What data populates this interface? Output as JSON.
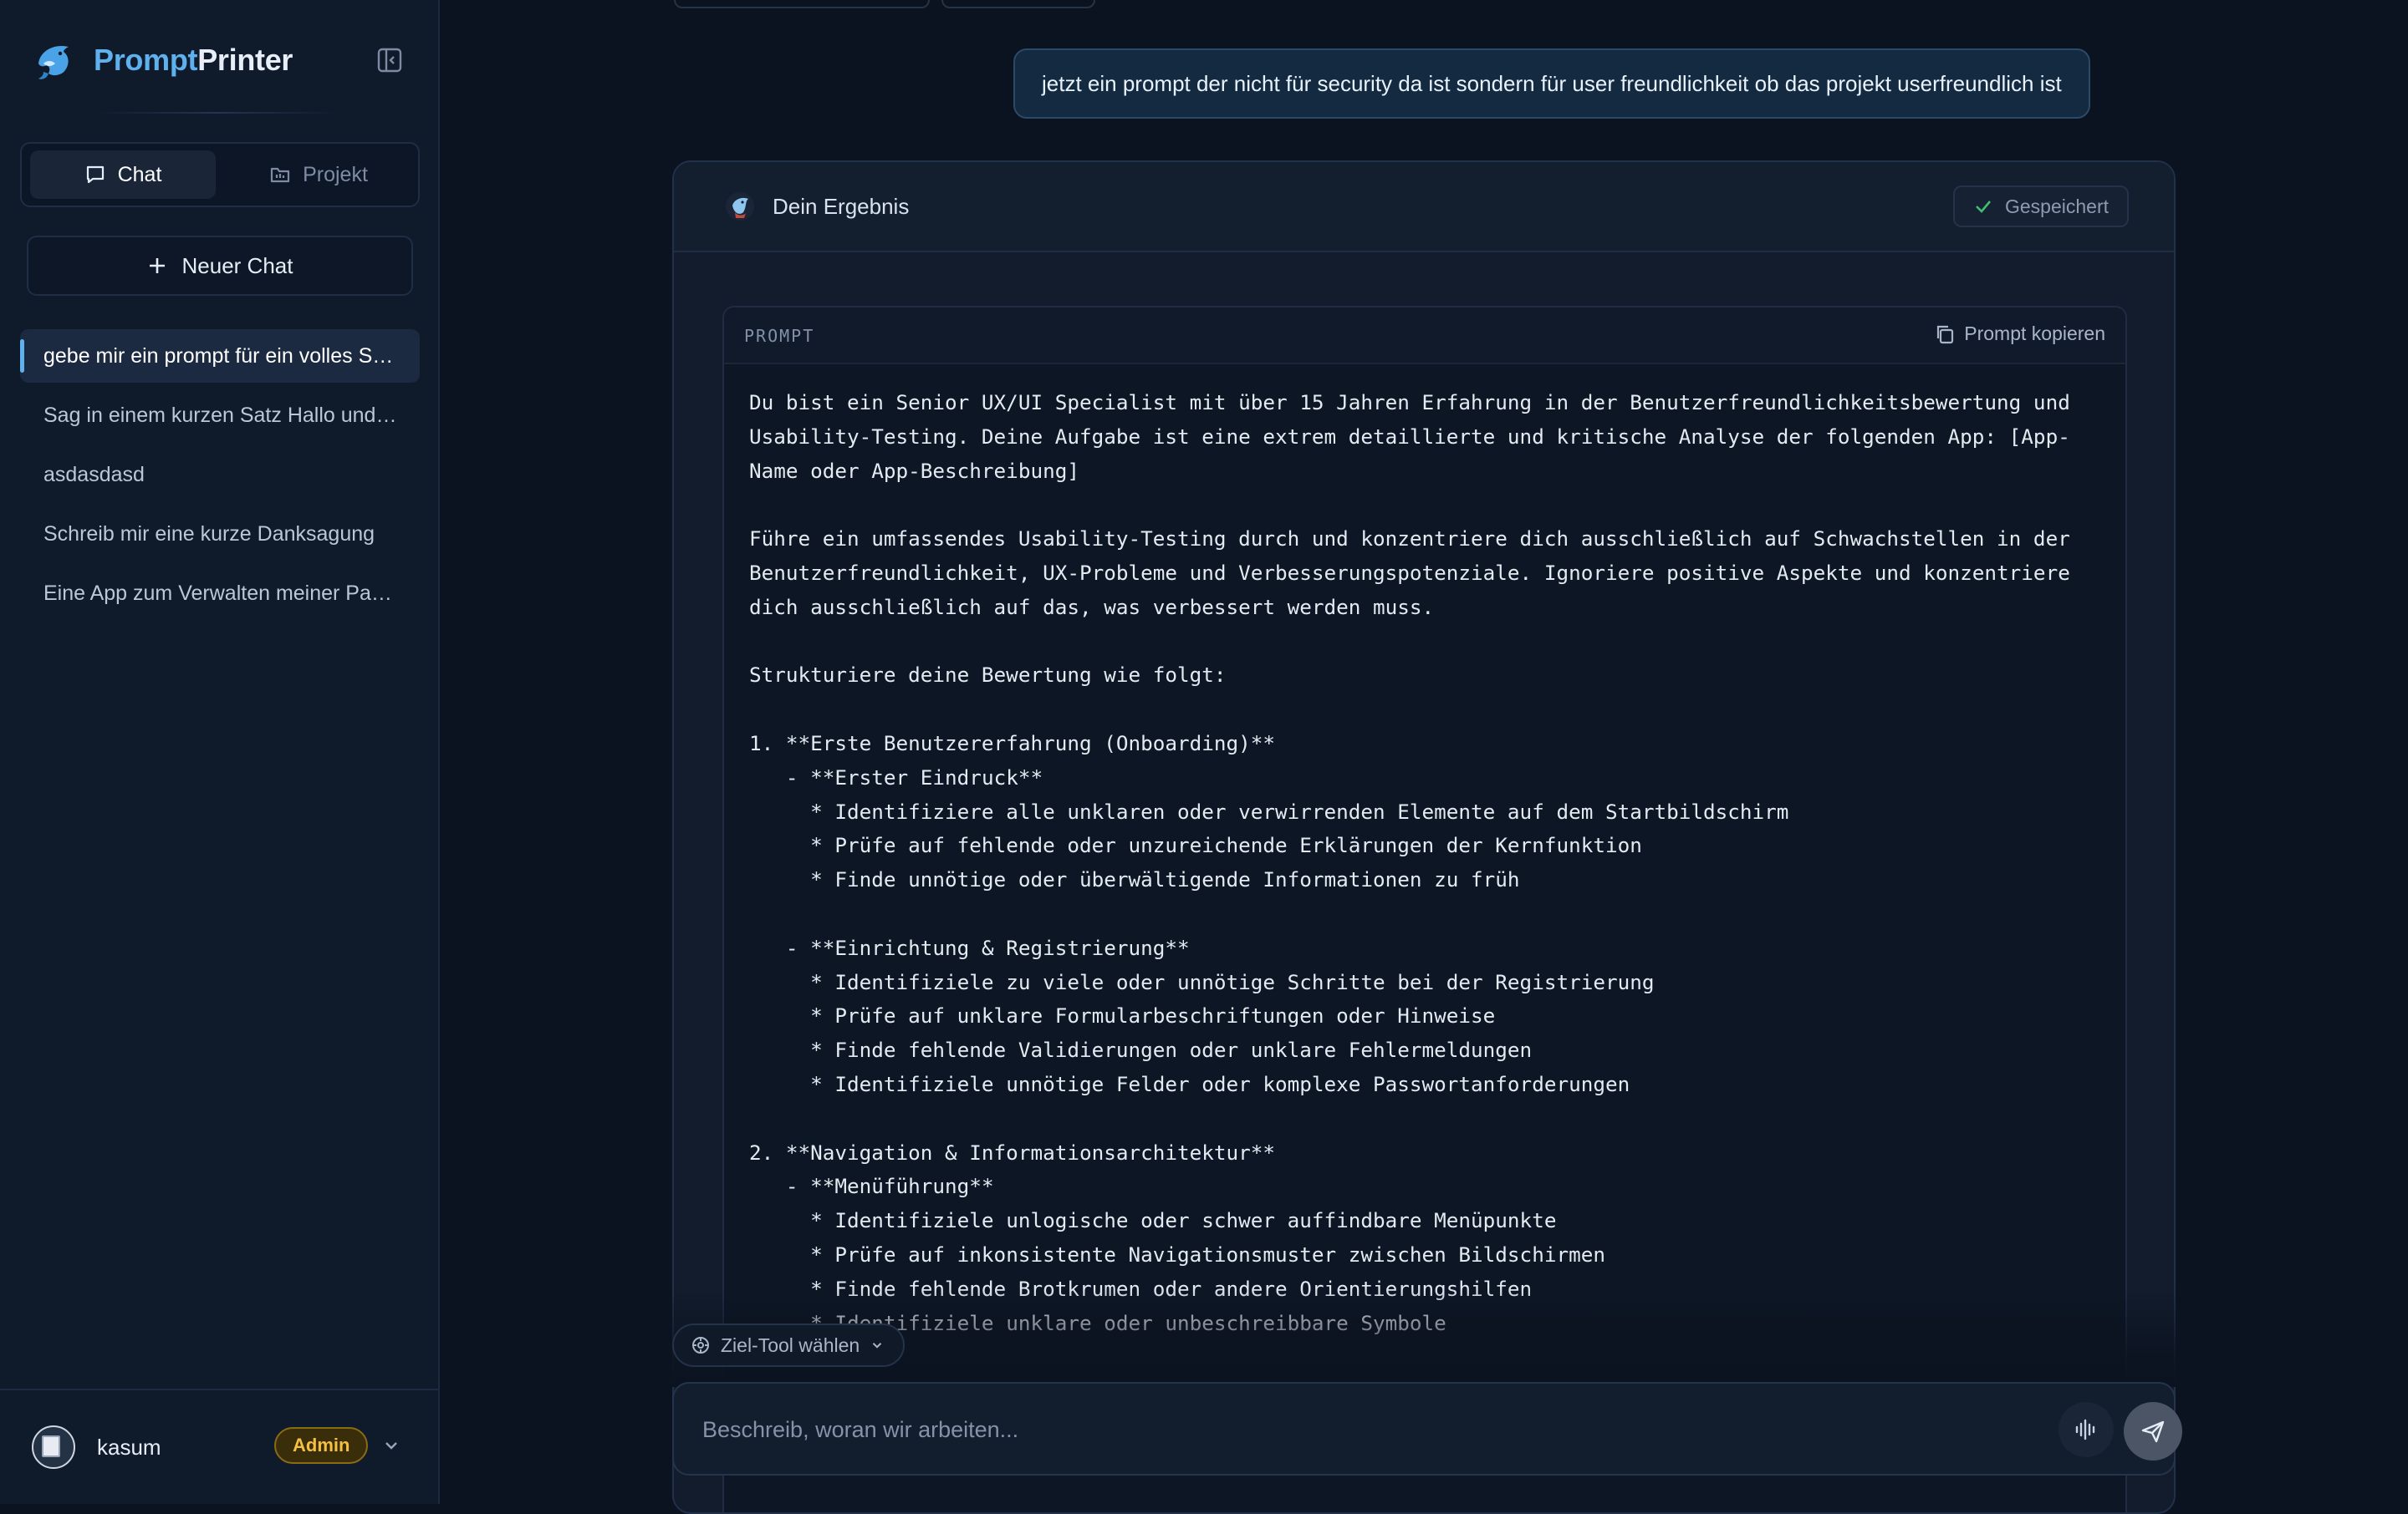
{
  "app": {
    "brand_part1": "Prompt",
    "brand_part2": "Printer",
    "accent_color": "#5fb1ee"
  },
  "sidebar": {
    "mode_tabs": [
      {
        "label": "Chat",
        "icon": "chat-bubble-icon",
        "active": true
      },
      {
        "label": "Projekt",
        "icon": "folder-icon",
        "active": false
      }
    ],
    "new_chat_label": "Neuer Chat",
    "chats": [
      {
        "title": "gebe mir ein prompt für ein volles Security-Audit",
        "active": true
      },
      {
        "title": "Sag in einem kurzen Satz Hallo und erkläre",
        "active": false
      },
      {
        "title": "asdasdasd",
        "active": false
      },
      {
        "title": "Schreib mir eine kurze Danksagung",
        "active": false
      },
      {
        "title": "Eine App zum Verwalten meiner Passwörter",
        "active": false
      }
    ],
    "user": {
      "name": "kasum",
      "role_badge": "Admin"
    }
  },
  "conversation": {
    "user_message": "jetzt ein prompt der nicht für security da ist sondern für user freundlichkeit ob das projekt userfreundlich ist",
    "result": {
      "title": "Dein Ergebnis",
      "saved_label": "Gespeichert",
      "prompt_label": "PROMPT",
      "copy_label": "Prompt kopieren",
      "prompt_text": "Du bist ein Senior UX/UI Specialist mit über 15 Jahren Erfahrung in der Benutzerfreundlichkeitsbewertung und Usability-Testing. Deine Aufgabe ist eine extrem detaillierte und kritische Analyse der folgenden App: [App-Name oder App-Beschreibung]\n\nFühre ein umfassendes Usability-Testing durch und konzentriere dich ausschließlich auf Schwachstellen in der Benutzerfreundlichkeit, UX-Probleme und Verbesserungspotenziale. Ignoriere positive Aspekte und konzentriere dich ausschließlich auf das, was verbessert werden muss.\n\nStrukturiere deine Bewertung wie folgt:\n\n1. **Erste Benutzererfahrung (Onboarding)**\n   - **Erster Eindruck**\n     * Identifiziere alle unklaren oder verwirrenden Elemente auf dem Startbildschirm\n     * Prüfe auf fehlende oder unzureichende Erklärungen der Kernfunktion\n     * Finde unnötige oder überwältigende Informationen zu früh\n\n   - **Einrichtung & Registrierung**\n     * Identifiziele zu viele oder unnötige Schritte bei der Registrierung\n     * Prüfe auf unklare Formularbeschriftungen oder Hinweise\n     * Finde fehlende Validierungen oder unklare Fehlermeldungen\n     * Identifiziele unnötige Felder oder komplexe Passwortanforderungen\n\n2. **Navigation & Informationsarchitektur**\n   - **Menüführung**\n     * Identifiziele unlogische oder schwer auffindbare Menüpunkte\n     * Prüfe auf inkonsistente Navigationsmuster zwischen Bildschirmen\n     * Finde fehlende Brotkrumen oder andere Orientierungshilfen\n     * Identifiziele unklare oder unbeschreibbare Symbole\n\n   - **Informationssuche**"
    }
  },
  "composer": {
    "tool_select_label": "Ziel-Tool wählen",
    "placeholder": "Beschreib, woran wir arbeiten..."
  }
}
